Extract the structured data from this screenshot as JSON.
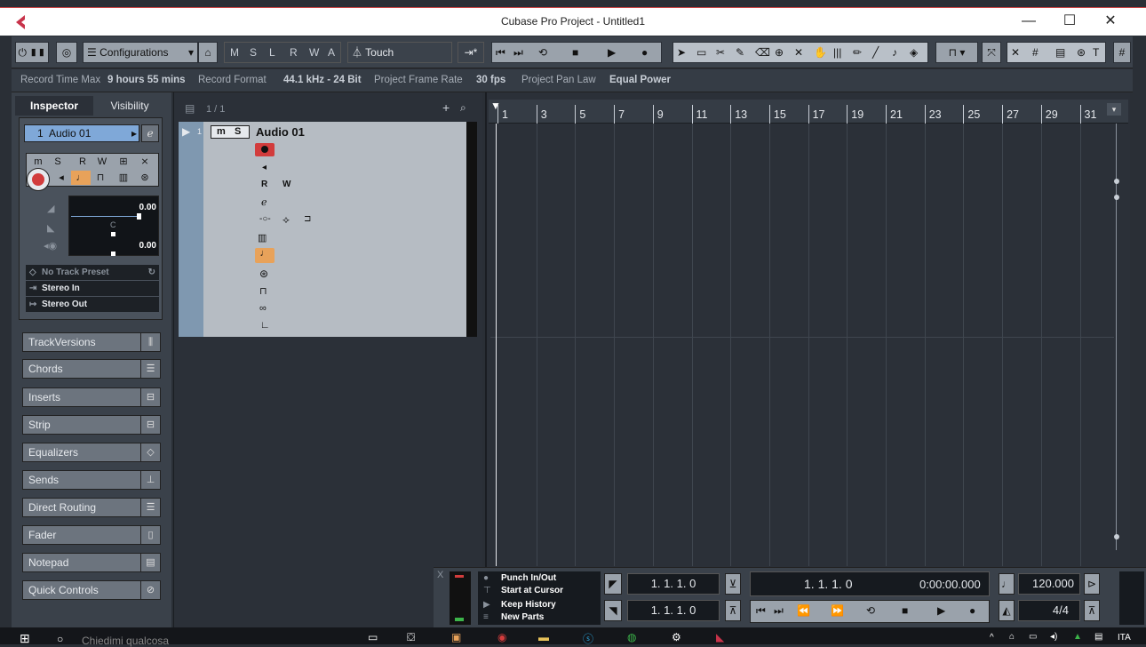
{
  "window": {
    "title": "Cubase Pro Project - Untitled1",
    "minimize_icon": "minimize-icon",
    "maximize_icon": "maximize-icon",
    "close_icon": "close-icon"
  },
  "toolbar": {
    "configurations_label": "Configurations",
    "m_label": "M",
    "s_label": "S",
    "l_label": "L",
    "r_label": "R",
    "w_label": "W",
    "a_label": "A",
    "automation_mode": "Touch"
  },
  "infoline": {
    "record_time_label": "Record Time Max",
    "record_time_value": "9 hours 55 mins",
    "record_format_label": "Record Format",
    "record_format_value": "44.1 kHz - 24 Bit",
    "frame_rate_label": "Project Frame Rate",
    "frame_rate_value": "30 fps",
    "pan_law_label": "Project Pan Law",
    "pan_law_value": "Equal Power"
  },
  "inspector": {
    "tab_inspector": "Inspector",
    "tab_visibility": "Visibility",
    "track_number": "1",
    "track_name": "Audio 01",
    "volume_value": "0.00",
    "pan_value": "C",
    "delay_value": "0.00",
    "track_preset": "No Track Preset",
    "input": "Stereo In",
    "output": "Stereo Out",
    "sections": [
      {
        "label": "TrackVersions"
      },
      {
        "label": "Chords"
      },
      {
        "label": "Inserts"
      },
      {
        "label": "Strip"
      },
      {
        "label": "Equalizers"
      },
      {
        "label": "Sends"
      },
      {
        "label": "Direct Routing"
      },
      {
        "label": "Fader"
      },
      {
        "label": "Notepad"
      },
      {
        "label": "Quick Controls"
      }
    ]
  },
  "tracklist": {
    "count": "1 / 1",
    "track_number": "1",
    "track_name": "Audio 01",
    "m": "m",
    "s": "S",
    "r": "R",
    "w": "W"
  },
  "ruler": {
    "bars": [
      "1",
      "3",
      "5",
      "7",
      "9",
      "11",
      "13",
      "15",
      "17",
      "19",
      "21",
      "23",
      "25",
      "27",
      "29",
      "31"
    ]
  },
  "transport": {
    "punch": "Punch In/Out",
    "start_cursor": "Start at Cursor",
    "keep_history": "Keep History",
    "new_parts": "New Parts",
    "left_locator": "1.  1.  1.    0",
    "right_locator": "1.  1.  1.    0",
    "position_bars": "1.   1.   1.     0",
    "position_time": "0:00:00.000",
    "tempo": "120.000",
    "signature": "4/4",
    "x_label": "X"
  },
  "taskbar": {
    "search_placeholder": "Chiedimi qualcosa",
    "lang": "ITA"
  },
  "colors": {
    "accent_red": "#d23c3c",
    "accent_orange": "#e8a25a",
    "bg_dark": "#2b3038",
    "panel": "#3a414a"
  }
}
